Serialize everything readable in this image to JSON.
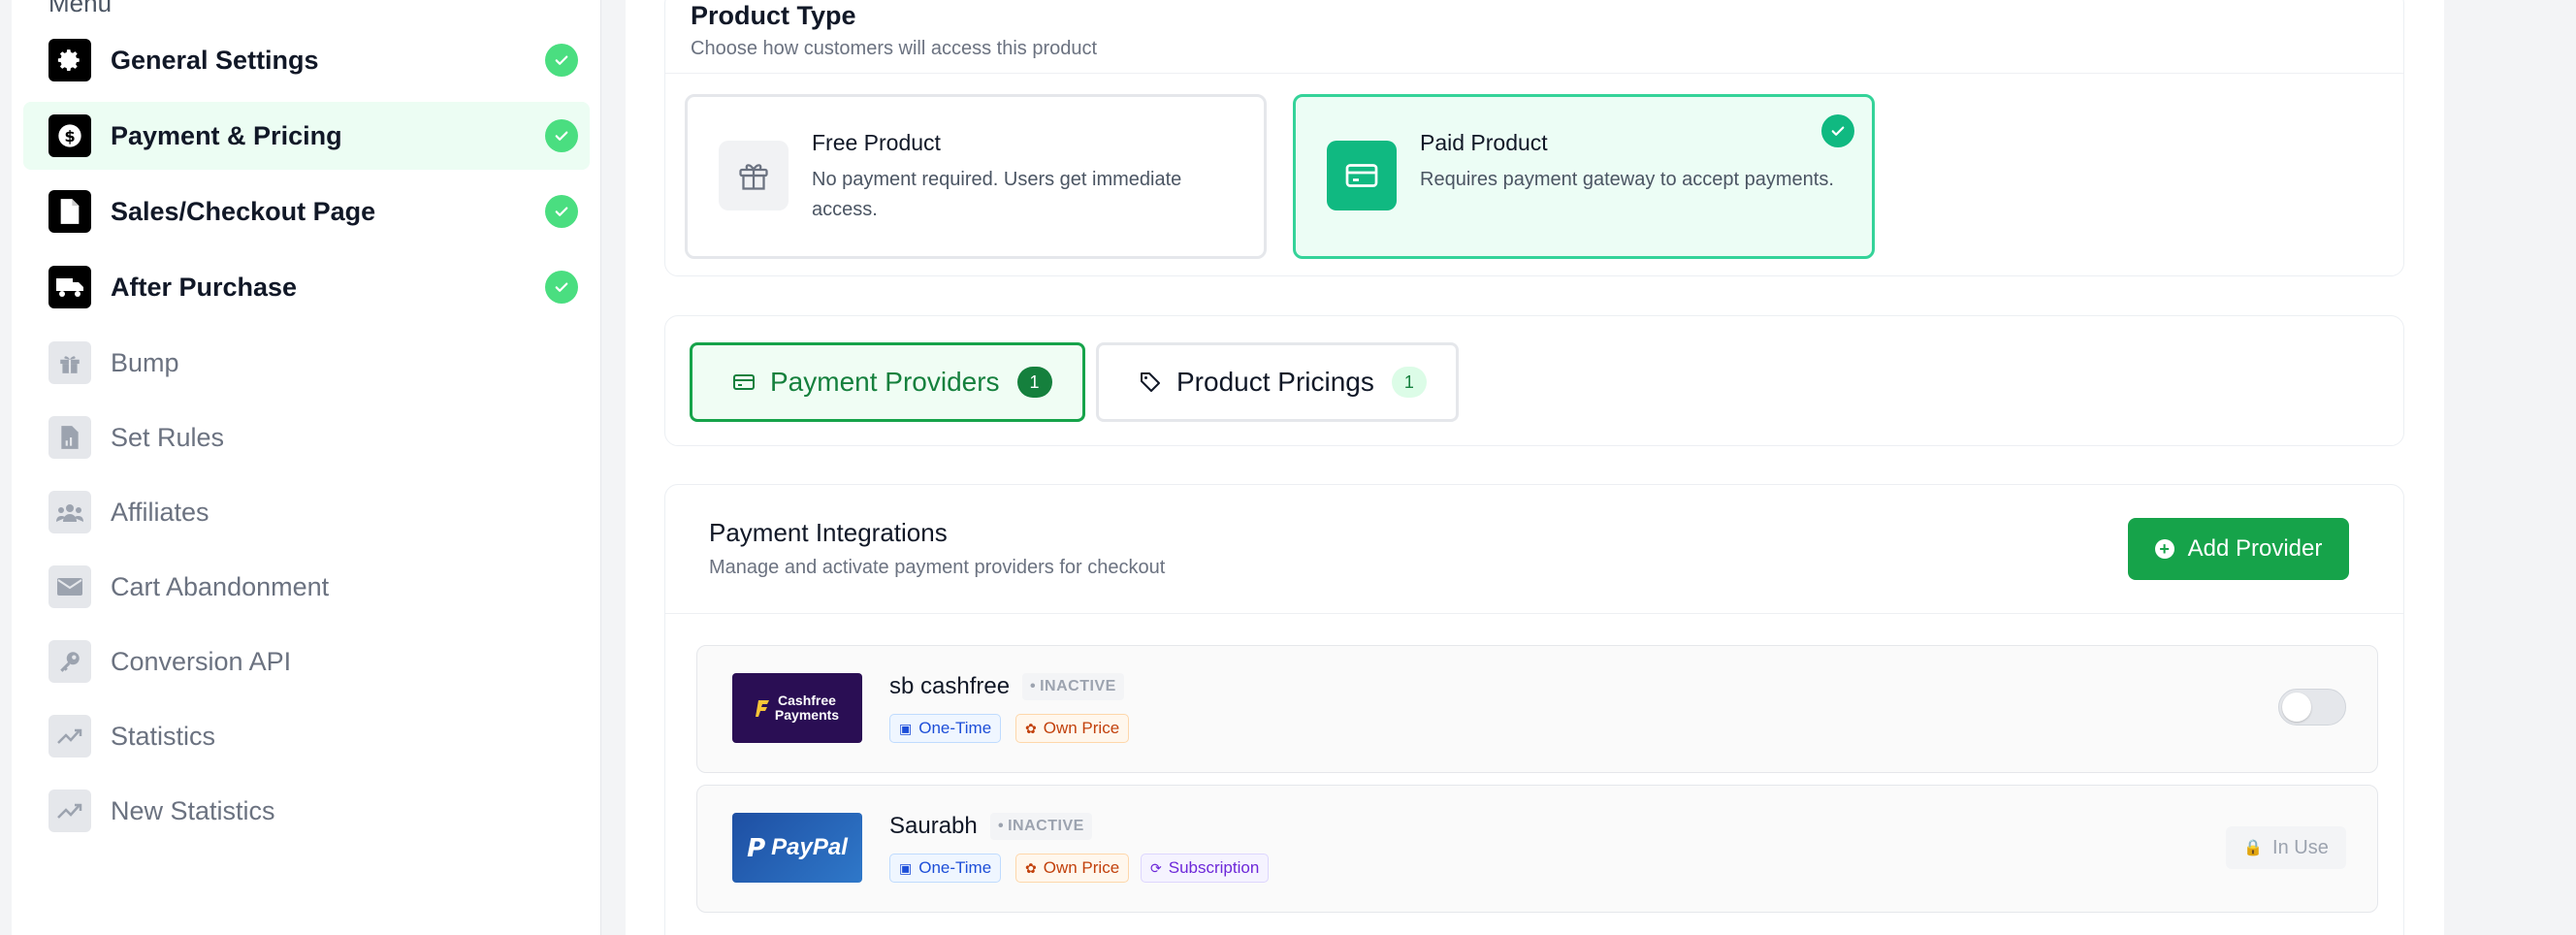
{
  "sidebar": {
    "menu_label": "Menu",
    "items": [
      {
        "label": "General Settings",
        "icon": "gear-icon",
        "done": true,
        "active": false
      },
      {
        "label": "Payment & Pricing",
        "icon": "dollar-icon",
        "done": true,
        "active": true
      },
      {
        "label": "Sales/Checkout Page",
        "icon": "file-icon",
        "done": true,
        "active": false
      },
      {
        "label": "After Purchase",
        "icon": "truck-icon",
        "done": true,
        "active": false
      },
      {
        "label": "Bump",
        "icon": "gift-icon",
        "done": false,
        "active": false
      },
      {
        "label": "Set Rules",
        "icon": "file-chart-icon",
        "done": false,
        "active": false
      },
      {
        "label": "Affiliates",
        "icon": "users-icon",
        "done": false,
        "active": false
      },
      {
        "label": "Cart Abandonment",
        "icon": "envelope-icon",
        "done": false,
        "active": false
      },
      {
        "label": "Conversion API",
        "icon": "key-icon",
        "done": false,
        "active": false
      },
      {
        "label": "Statistics",
        "icon": "trend-icon",
        "done": false,
        "active": false
      },
      {
        "label": "New Statistics",
        "icon": "trend-icon",
        "done": false,
        "active": false
      }
    ]
  },
  "product_type": {
    "title": "Product Type",
    "subtitle": "Choose how customers will access this product",
    "options": [
      {
        "title": "Free Product",
        "description": "No payment required. Users get immediate access.",
        "selected": false
      },
      {
        "title": "Paid Product",
        "description": "Requires payment gateway to accept payments.",
        "selected": true
      }
    ]
  },
  "tabs": [
    {
      "label": "Payment Providers",
      "count": "1",
      "active": true
    },
    {
      "label": "Product Pricings",
      "count": "1",
      "active": false
    }
  ],
  "integrations": {
    "title": "Payment Integrations",
    "subtitle": "Manage and activate payment providers for checkout",
    "add_button": "Add Provider",
    "providers": [
      {
        "name": "sb cashfree",
        "logo_text_1": "Cashfree",
        "logo_text_2": "Payments",
        "status": "INACTIVE",
        "tags": [
          "One-Time",
          "Own Price"
        ],
        "action": "toggle"
      },
      {
        "name": "Saurabh",
        "logo_text_1": "PayPal",
        "status": "INACTIVE",
        "tags": [
          "One-Time",
          "Own Price",
          "Subscription"
        ],
        "action": "In Use"
      }
    ]
  },
  "colors": {
    "accent": "#16a34a",
    "paid_selected": "#10b981",
    "check": "#4ade80"
  }
}
